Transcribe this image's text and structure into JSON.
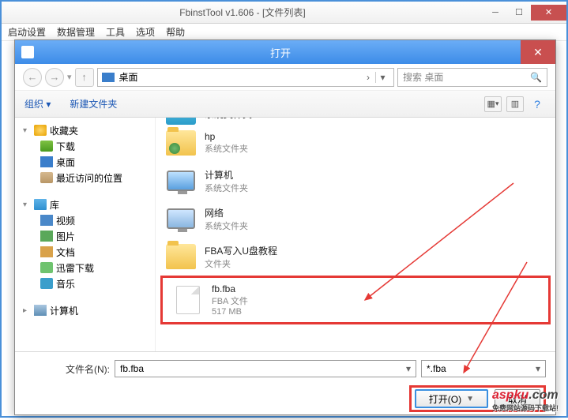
{
  "app": {
    "title": "FbinstTool v1.606 - [文件列表]",
    "menu": [
      "启动设置",
      "数据管理",
      "工具",
      "选项",
      "帮助"
    ]
  },
  "dialog": {
    "title": "打开",
    "path_label": "桌面",
    "search_placeholder": "搜索 桌面",
    "toolbar": {
      "organize": "组织 ▾",
      "newfolder": "新建文件夹"
    },
    "filename_label": "文件名(N):",
    "filename_value": "fb.fba",
    "filter": "*.fba",
    "open_btn": "打开(O)",
    "cancel_btn": "取消"
  },
  "tree": {
    "fav": "收藏夹",
    "fav_items": [
      "下载",
      "桌面",
      "最近访问的位置"
    ],
    "lib": "库",
    "lib_items": [
      "视频",
      "图片",
      "文档",
      "迅雷下载",
      "音乐"
    ],
    "computer": "计算机"
  },
  "items": [
    {
      "name": "系统文件夹",
      "sub": ""
    },
    {
      "name": "hp",
      "sub": "系统文件夹"
    },
    {
      "name": "计算机",
      "sub": "系统文件夹"
    },
    {
      "name": "网络",
      "sub": "系统文件夹"
    },
    {
      "name": "FBA写入U盘教程",
      "sub": "文件夹"
    }
  ],
  "selected": {
    "name": "fb.fba",
    "type": "FBA 文件",
    "size": "517 MB"
  },
  "watermark": {
    "main": "aspku",
    "tld": ".com",
    "sub": "免费网站源码下载站!"
  }
}
